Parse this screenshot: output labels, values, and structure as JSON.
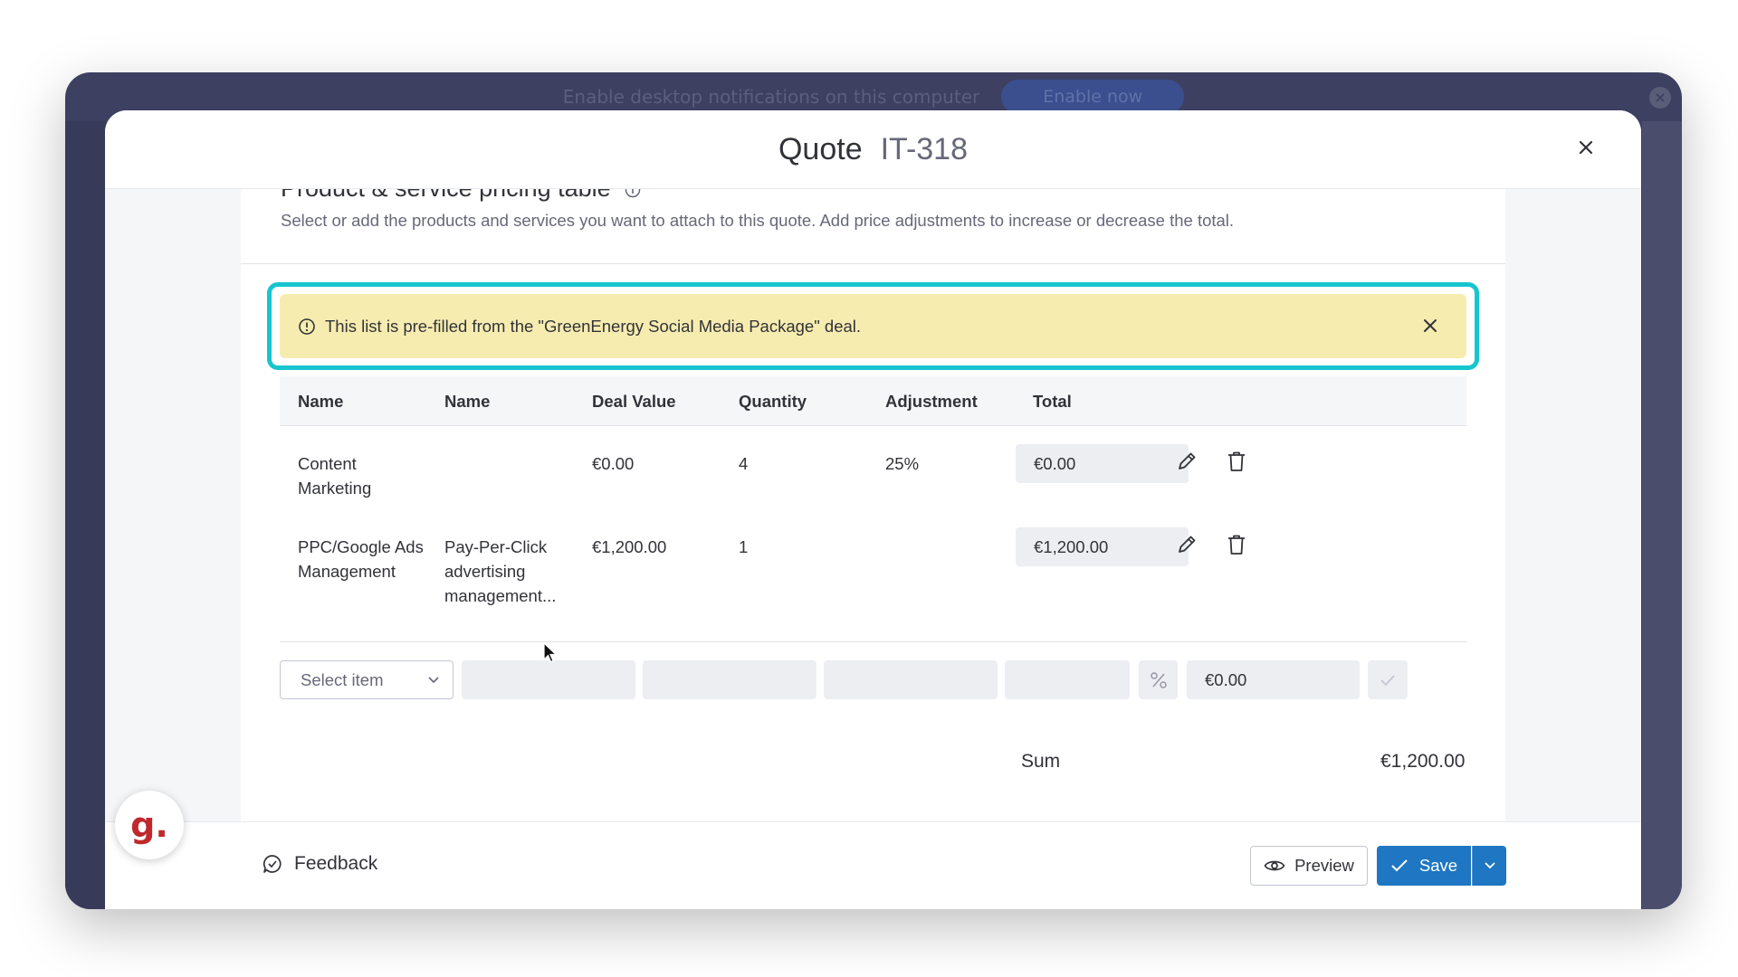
{
  "app": {
    "notification_text": "Enable desktop notifications on this computer",
    "notification_button": "Enable now"
  },
  "modal": {
    "title": "Quote",
    "quote_id": "IT-318"
  },
  "section": {
    "title": "Product & service pricing table",
    "description": "Select or add the products and services you want to attach to this quote. Add price adjustments to increase or decrease the total."
  },
  "banner": {
    "text": "This list is pre-filled from the \"GreenEnergy Social Media Package\" deal."
  },
  "table": {
    "columns": [
      "Name",
      "Name",
      "Deal Value",
      "Quantity",
      "Adjustment",
      "Total"
    ],
    "rows": [
      {
        "name": "Content Marketing",
        "description": "",
        "deal_value": "€0.00",
        "quantity": "4",
        "adjustment": "25%",
        "total": "€0.00"
      },
      {
        "name": "PPC/Google Ads Management",
        "description": "Pay-Per-Click advertising management...",
        "deal_value": "€1,200.00",
        "quantity": "1",
        "adjustment": "",
        "total": "€1,200.00"
      }
    ]
  },
  "new_row": {
    "select_placeholder": "Select item",
    "total": "€0.00"
  },
  "summary": {
    "sum_label": "Sum",
    "sum_value": "€1,200.00"
  },
  "footer": {
    "feedback": "Feedback",
    "preview": "Preview",
    "save": "Save"
  },
  "branding": {
    "logo_letter": "g."
  },
  "colors": {
    "highlight": "#17c5cf",
    "banner_bg": "#f7ecb0",
    "primary": "#1f76c2",
    "logo": "#c0282d"
  }
}
